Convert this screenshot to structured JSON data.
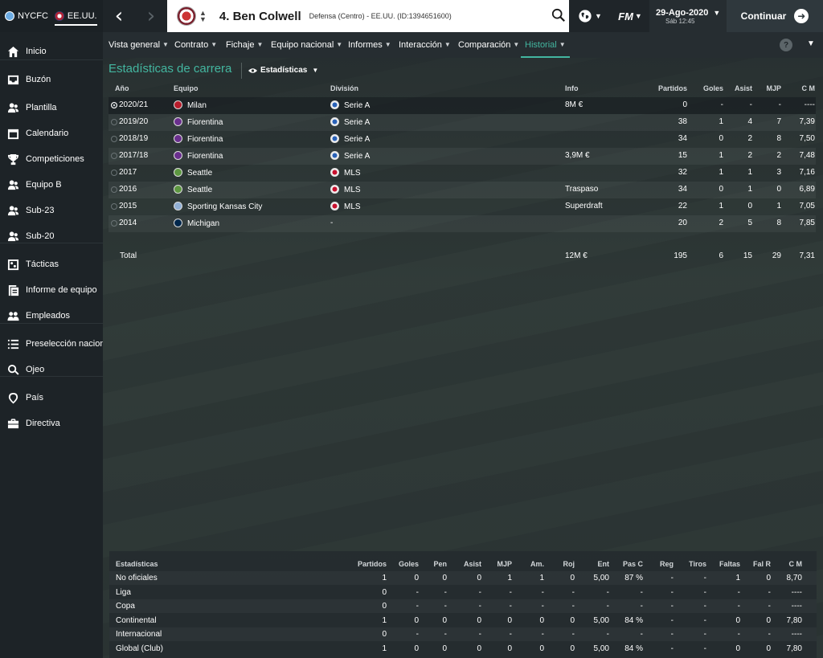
{
  "club_tabs": [
    {
      "label": "NYCFC",
      "color": "#6cace4"
    },
    {
      "label": "EE.UU.",
      "color": "#b22234"
    }
  ],
  "player": {
    "name": "4. Ben Colwell",
    "subtitle": "Defensa (Centro) - EE.UU. (ID:1394651600)"
  },
  "fm_label": "FM",
  "date": {
    "main": "29-Ago-2020",
    "sub": "Sáb 12:45"
  },
  "continue_label": "Continuar",
  "sidebar": {
    "items": [
      {
        "label": "Inicio",
        "icon": "home-icon"
      },
      {
        "label": "Buzón",
        "icon": "inbox-icon"
      },
      {
        "label": "Plantilla",
        "icon": "squad-icon"
      },
      {
        "label": "Calendario",
        "icon": "calendar-icon"
      },
      {
        "label": "Competiciones",
        "icon": "trophy-icon"
      },
      {
        "label": "Equipo B",
        "icon": "squad-icon"
      },
      {
        "label": "Sub-23",
        "icon": "squad-icon"
      },
      {
        "label": "Sub-20",
        "icon": "squad-icon"
      },
      {
        "label": "Tácticas",
        "icon": "tactics-icon"
      },
      {
        "label": "Informe de equipo",
        "icon": "report-icon"
      },
      {
        "label": "Empleados",
        "icon": "staff-icon"
      },
      {
        "label": "Preselección nacional",
        "icon": "list-icon"
      },
      {
        "label": "Ojeo",
        "icon": "search-icon"
      },
      {
        "label": "País",
        "icon": "location-icon"
      },
      {
        "label": "Directiva",
        "icon": "briefcase-icon"
      }
    ]
  },
  "subnav": {
    "tabs": [
      {
        "label": "Vista general"
      },
      {
        "label": "Contrato"
      },
      {
        "label": "Fichaje"
      },
      {
        "label": "Equipo nacional"
      },
      {
        "label": "Informes"
      },
      {
        "label": "Interacción"
      },
      {
        "label": "Comparación"
      },
      {
        "label": "Historial",
        "active": true
      }
    ]
  },
  "section": {
    "title": "Estadísticas de carrera",
    "view_label": "Estadísticas"
  },
  "career": {
    "columns": {
      "year": "Año",
      "team": "Equipo",
      "division": "División",
      "info": "Info",
      "apps": "Partidos",
      "goals": "Goles",
      "assists": "Asist",
      "pom": "MJP",
      "rating": "C M"
    },
    "rows": [
      {
        "year": "2020/21",
        "team": "Milan",
        "team_color": "#b71c2b",
        "division": "Serie A",
        "div_color": "#2a62b8",
        "info": "8M €",
        "apps": "0",
        "goals": "-",
        "assists": "-",
        "pom": "-",
        "rating": "----"
      },
      {
        "year": "2019/20",
        "team": "Fiorentina",
        "team_color": "#6a2f8e",
        "division": "Serie A",
        "div_color": "#2a62b8",
        "info": "",
        "apps": "38",
        "goals": "1",
        "assists": "4",
        "pom": "7",
        "rating": "7,39"
      },
      {
        "year": "2018/19",
        "team": "Fiorentina",
        "team_color": "#6a2f8e",
        "division": "Serie A",
        "div_color": "#2a62b8",
        "info": "",
        "apps": "34",
        "goals": "0",
        "assists": "2",
        "pom": "8",
        "rating": "7,50"
      },
      {
        "year": "2017/18",
        "team": "Fiorentina",
        "team_color": "#6a2f8e",
        "division": "Serie A",
        "div_color": "#2a62b8",
        "info": "3,9M €",
        "apps": "15",
        "goals": "1",
        "assists": "2",
        "pom": "2",
        "rating": "7,48"
      },
      {
        "year": "2017",
        "team": "Seattle",
        "team_color": "#5d9741",
        "division": "MLS",
        "div_color": "#c8102e",
        "info": "",
        "apps": "32",
        "goals": "1",
        "assists": "1",
        "pom": "3",
        "rating": "7,16"
      },
      {
        "year": "2016",
        "team": "Seattle",
        "team_color": "#5d9741",
        "division": "MLS",
        "div_color": "#c8102e",
        "info": "Traspaso",
        "apps": "34",
        "goals": "0",
        "assists": "1",
        "pom": "0",
        "rating": "6,89"
      },
      {
        "year": "2015",
        "team": "Sporting Kansas City",
        "team_color": "#91b0d5",
        "division": "MLS",
        "div_color": "#c8102e",
        "info": "Superdraft",
        "apps": "22",
        "goals": "1",
        "assists": "0",
        "pom": "1",
        "rating": "7,05"
      },
      {
        "year": "2014",
        "team": "Michigan",
        "team_color": "#00274c",
        "division": "-",
        "div_color": "",
        "info": "",
        "apps": "20",
        "goals": "2",
        "assists": "5",
        "pom": "8",
        "rating": "7,85"
      }
    ],
    "total": {
      "label": "Total",
      "info": "12M €",
      "apps": "195",
      "goals": "6",
      "assists": "15",
      "pom": "29",
      "rating": "7,31"
    }
  },
  "stats": {
    "columns": [
      "Estadísticas",
      "Partidos",
      "Goles",
      "Pen",
      "Asist",
      "MJP",
      "Am.",
      "Roj",
      "Ent",
      "Pas C",
      "Reg",
      "Tiros",
      "Faltas",
      "Fal R",
      "C M"
    ],
    "rows": [
      [
        "No oficiales",
        "1",
        "0",
        "0",
        "0",
        "1",
        "1",
        "0",
        "5,00",
        "87 %",
        "-",
        "-",
        "1",
        "0",
        "8,70"
      ],
      [
        "Liga",
        "0",
        "-",
        "-",
        "-",
        "-",
        "-",
        "-",
        "-",
        "-",
        "-",
        "-",
        "-",
        "-",
        "----"
      ],
      [
        "Copa",
        "0",
        "-",
        "-",
        "-",
        "-",
        "-",
        "-",
        "-",
        "-",
        "-",
        "-",
        "-",
        "-",
        "----"
      ],
      [
        "Continental",
        "1",
        "0",
        "0",
        "0",
        "0",
        "0",
        "0",
        "5,00",
        "84 %",
        "-",
        "-",
        "0",
        "0",
        "7,80"
      ],
      [
        "Internacional",
        "0",
        "-",
        "-",
        "-",
        "-",
        "-",
        "-",
        "-",
        "-",
        "-",
        "-",
        "-",
        "-",
        "----"
      ],
      [
        "Global (Club)",
        "1",
        "0",
        "0",
        "0",
        "0",
        "0",
        "0",
        "5,00",
        "84 %",
        "-",
        "-",
        "0",
        "0",
        "7,80"
      ]
    ]
  }
}
